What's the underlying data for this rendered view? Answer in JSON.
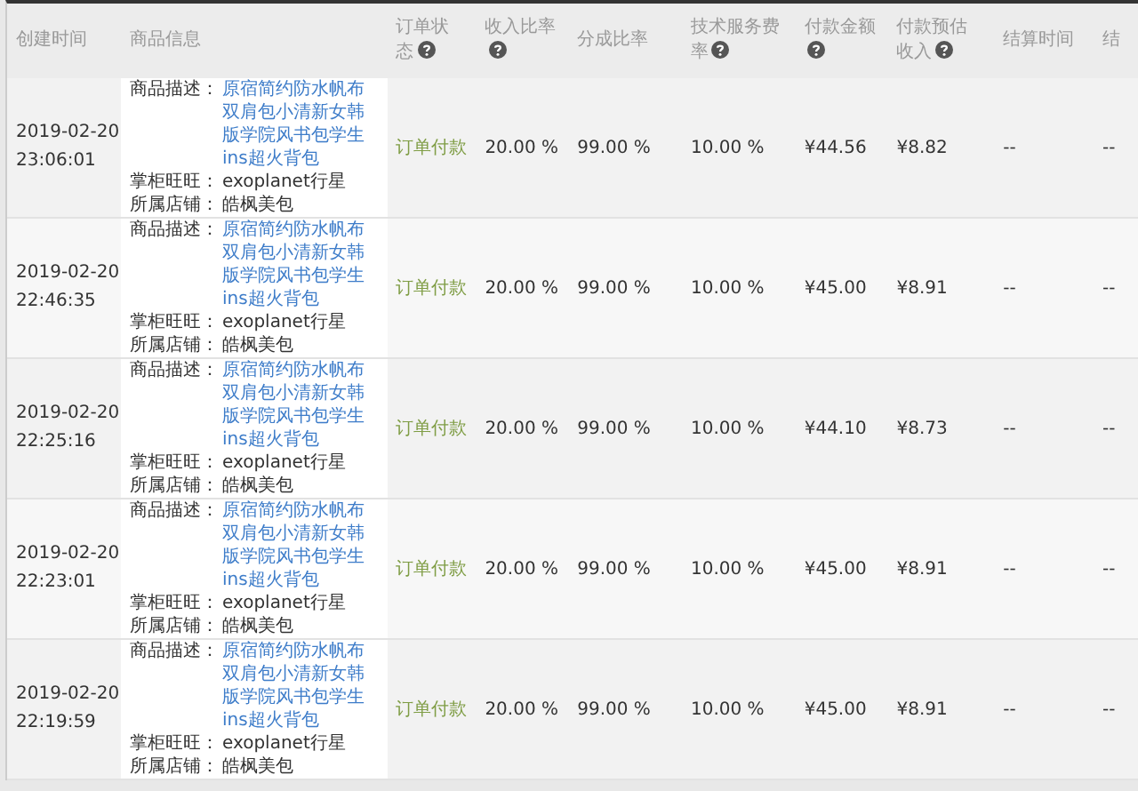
{
  "columns": [
    {
      "label": "创建时间",
      "help": false
    },
    {
      "label": "商品信息",
      "help": false
    },
    {
      "label": "订单状态",
      "help": true
    },
    {
      "label": "收入比率",
      "help": true
    },
    {
      "label": "分成比率",
      "help": false
    },
    {
      "label": "技术服务费率",
      "help": true
    },
    {
      "label": "付款金额",
      "help": true
    },
    {
      "label": "付款预估收入",
      "help": true
    },
    {
      "label": "结算时间",
      "help": false
    },
    {
      "label": "结",
      "help": false
    }
  ],
  "rows": [
    {
      "time": [
        "2019-02-20",
        "23:06:01"
      ],
      "desc_label": "商品描述：",
      "desc": "原宿简约防水帆布双肩包小清新女韩版学院风书包学生ins超火背包",
      "seller_label": "掌柜旺旺：",
      "seller": "exoplanet行星",
      "shop_label": "所属店铺：",
      "shop": "皓枫美包",
      "status": "订单付款",
      "income_rate": "20.00 %",
      "share_rate": "99.00 %",
      "fee_rate": "10.00 %",
      "amount": "¥44.56",
      "estimate": "¥8.82",
      "settle_time": "--",
      "last": "--"
    },
    {
      "time": [
        "2019-02-20",
        "22:46:35"
      ],
      "desc_label": "商品描述：",
      "desc": "原宿简约防水帆布双肩包小清新女韩版学院风书包学生ins超火背包",
      "seller_label": "掌柜旺旺：",
      "seller": "exoplanet行星",
      "shop_label": "所属店铺：",
      "shop": "皓枫美包",
      "status": "订单付款",
      "income_rate": "20.00 %",
      "share_rate": "99.00 %",
      "fee_rate": "10.00 %",
      "amount": "¥45.00",
      "estimate": "¥8.91",
      "settle_time": "--",
      "last": "--"
    },
    {
      "time": [
        "2019-02-20",
        "22:25:16"
      ],
      "desc_label": "商品描述：",
      "desc": "原宿简约防水帆布双肩包小清新女韩版学院风书包学生ins超火背包",
      "seller_label": "掌柜旺旺：",
      "seller": "exoplanet行星",
      "shop_label": "所属店铺：",
      "shop": "皓枫美包",
      "status": "订单付款",
      "income_rate": "20.00 %",
      "share_rate": "99.00 %",
      "fee_rate": "10.00 %",
      "amount": "¥44.10",
      "estimate": "¥8.73",
      "settle_time": "--",
      "last": "--"
    },
    {
      "time": [
        "2019-02-20",
        "22:23:01"
      ],
      "desc_label": "商品描述：",
      "desc": "原宿简约防水帆布双肩包小清新女韩版学院风书包学生ins超火背包",
      "seller_label": "掌柜旺旺：",
      "seller": "exoplanet行星",
      "shop_label": "所属店铺：",
      "shop": "皓枫美包",
      "status": "订单付款",
      "income_rate": "20.00 %",
      "share_rate": "99.00 %",
      "fee_rate": "10.00 %",
      "amount": "¥45.00",
      "estimate": "¥8.91",
      "settle_time": "--",
      "last": "--"
    },
    {
      "time": [
        "2019-02-20",
        "22:19:59"
      ],
      "desc_label": "商品描述：",
      "desc": "原宿简约防水帆布双肩包小清新女韩版学院风书包学生ins超火背包",
      "seller_label": "掌柜旺旺：",
      "seller": "exoplanet行星",
      "shop_label": "所属店铺：",
      "shop": "皓枫美包",
      "status": "订单付款",
      "income_rate": "20.00 %",
      "share_rate": "99.00 %",
      "fee_rate": "10.00 %",
      "amount": "¥45.00",
      "estimate": "¥8.91",
      "settle_time": "--",
      "last": "--"
    }
  ]
}
